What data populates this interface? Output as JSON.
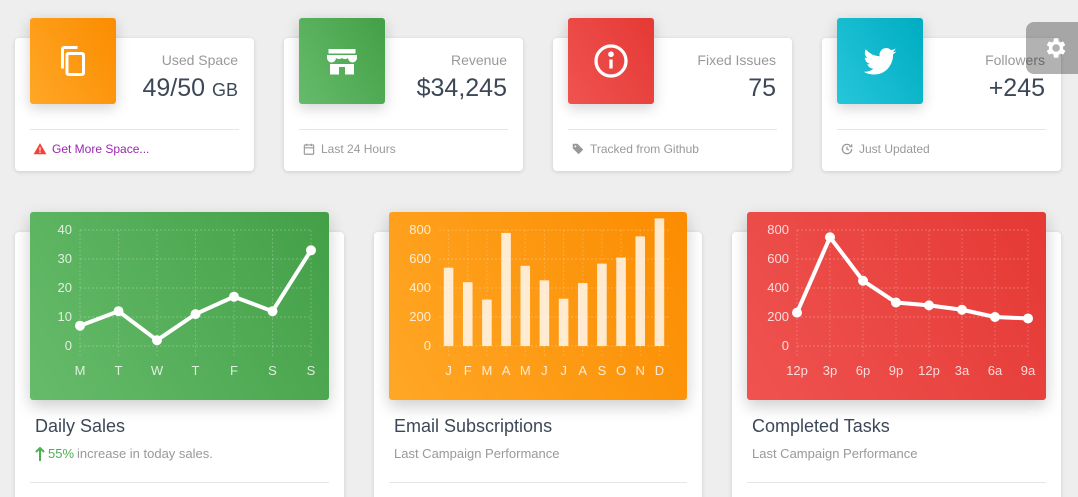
{
  "stats": [
    {
      "category": "Used Space",
      "value": "49/50",
      "unit": "GB",
      "footer": "Get More Space...",
      "icon": "copy-icon",
      "footer_icon": "warning-icon",
      "color_from": "#ffa726",
      "color_to": "#fb8c00"
    },
    {
      "category": "Revenue",
      "value": "$34,245",
      "unit": "",
      "footer": "Last 24 Hours",
      "icon": "store-icon",
      "footer_icon": "calendar-icon",
      "color_from": "#66bb6a",
      "color_to": "#43a047"
    },
    {
      "category": "Fixed Issues",
      "value": "75",
      "unit": "",
      "footer": "Tracked from Github",
      "icon": "info-icon",
      "footer_icon": "tag-icon",
      "color_from": "#ef5350",
      "color_to": "#e53935"
    },
    {
      "category": "Followers",
      "value": "+245",
      "unit": "",
      "footer": "Just Updated",
      "icon": "twitter-icon",
      "footer_icon": "update-icon",
      "color_from": "#26c6da",
      "color_to": "#00acc1"
    }
  ],
  "charts": [
    {
      "title": "Daily Sales",
      "sub_pct": "55%",
      "sub_text": "increase in today sales.",
      "sub_icon": "arrow-up-icon",
      "color_from": "#66bb6a",
      "color_to": "#43a047"
    },
    {
      "title": "Email Subscriptions",
      "sub_text": "Last Campaign Performance",
      "color_from": "#ffa726",
      "color_to": "#fb8c00"
    },
    {
      "title": "Completed Tasks",
      "sub_text": "Last Campaign Performance",
      "color_from": "#ef5350",
      "color_to": "#e53935"
    }
  ],
  "settings": {
    "icon": "gear-icon"
  },
  "chart_data": [
    {
      "type": "line",
      "categories": [
        "M",
        "T",
        "W",
        "T",
        "F",
        "S",
        "S"
      ],
      "series": [
        {
          "values": [
            7,
            12,
            2,
            11,
            17,
            12,
            33
          ]
        }
      ],
      "yticks": [
        "0",
        "10",
        "20",
        "30",
        "40"
      ],
      "ylim": [
        0,
        40
      ],
      "grid": true
    },
    {
      "type": "bar",
      "categories": [
        "J",
        "F",
        "M",
        "A",
        "M",
        "J",
        "J",
        "A",
        "S",
        "O",
        "N",
        "D"
      ],
      "series": [
        {
          "values": [
            540,
            440,
            320,
            780,
            553,
            453,
            326,
            434,
            568,
            610,
            756,
            880
          ]
        }
      ],
      "yticks": [
        "0",
        "200",
        "400",
        "600",
        "800"
      ],
      "ylim": [
        0,
        800
      ],
      "grid": true
    },
    {
      "type": "line",
      "categories": [
        "12p",
        "3p",
        "6p",
        "9p",
        "12p",
        "3a",
        "6a",
        "9a"
      ],
      "series": [
        {
          "values": [
            230,
            750,
            450,
            300,
            280,
            250,
            200,
            190
          ]
        }
      ],
      "yticks": [
        "0",
        "200",
        "400",
        "600",
        "800"
      ],
      "ylim": [
        0,
        800
      ],
      "grid": true
    }
  ]
}
